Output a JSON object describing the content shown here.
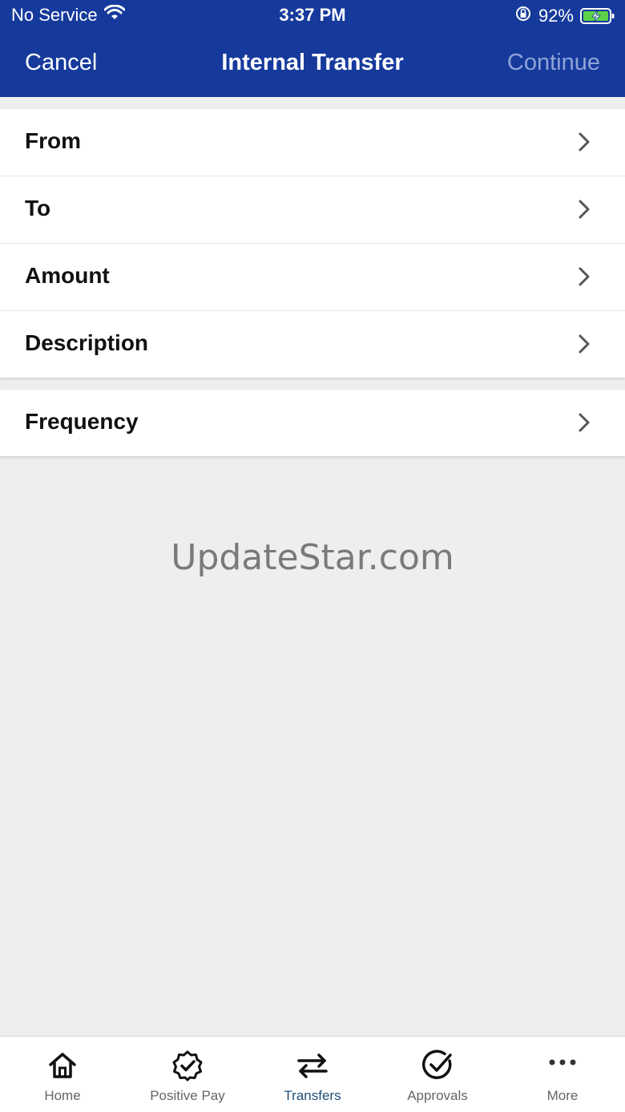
{
  "status_bar": {
    "carrier": "No Service",
    "time": "3:37 PM",
    "battery_percent": "92%",
    "icons": [
      "wifi-icon",
      "orientation-lock-icon",
      "battery-charging-icon"
    ]
  },
  "nav": {
    "cancel_label": "Cancel",
    "title": "Internal Transfer",
    "continue_label": "Continue"
  },
  "form": {
    "primary_rows": [
      {
        "label": "From"
      },
      {
        "label": "To"
      },
      {
        "label": "Amount"
      },
      {
        "label": "Description"
      }
    ],
    "secondary_rows": [
      {
        "label": "Frequency"
      }
    ]
  },
  "watermark": "UpdateStar.com",
  "tabs": [
    {
      "label": "Home",
      "icon": "home-icon",
      "active": false
    },
    {
      "label": "Positive Pay",
      "icon": "verified-badge-icon",
      "active": false
    },
    {
      "label": "Transfers",
      "icon": "transfer-arrows-icon",
      "active": true
    },
    {
      "label": "Approvals",
      "icon": "check-circle-icon",
      "active": false
    },
    {
      "label": "More",
      "icon": "more-dots-icon",
      "active": false
    }
  ],
  "colors": {
    "header_bg": "#163a9c",
    "continue_disabled": "#8fa3d6",
    "tab_active": "#1f4e79",
    "page_bg": "#eeeeee"
  }
}
